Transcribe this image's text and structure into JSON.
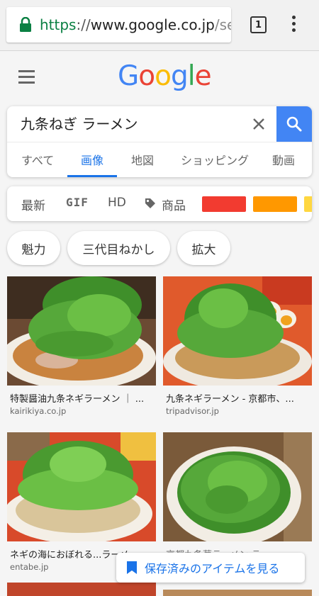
{
  "browser": {
    "url_scheme": "https",
    "url_sep": "://",
    "url_host": "www.google.co.jp",
    "url_path": "/sea",
    "tab_count": "1"
  },
  "google": {
    "logo_letters": [
      "G",
      "o",
      "o",
      "g",
      "l",
      "e"
    ],
    "query": "九条ねぎ ラーメン",
    "tabs": [
      {
        "label": "すべて",
        "active": false
      },
      {
        "label": "画像",
        "active": true
      },
      {
        "label": "地図",
        "active": false
      },
      {
        "label": "ショッピング",
        "active": false
      },
      {
        "label": "動画",
        "active": false
      }
    ]
  },
  "filters": {
    "latest": "最新",
    "gif": "GIF",
    "hd": "HD",
    "product": "商品",
    "color_swatches": [
      "#f23b30",
      "#ff9800",
      "#ffd740"
    ]
  },
  "chips": [
    "魁力",
    "三代目ねかし",
    "拡大"
  ],
  "results": [
    {
      "title": "特製醤油九条ネギラーメン ｜ ...",
      "site": "kairikiya.co.jp"
    },
    {
      "title": "九条ネギラーメン - 京都市、...",
      "site": "tripadvisor.jp"
    },
    {
      "title": "ネギの海におぼれる...ラーメ...",
      "site": "entabe.jp"
    },
    {
      "title": "京都九条葱ラーメン ラー ...",
      "site": ""
    }
  ],
  "saved_items_label": "保存済みのアイテムを見る",
  "colors": {
    "accent": "#1a73e8",
    "search_button": "#4285f4",
    "secure_green": "#0b8043"
  }
}
